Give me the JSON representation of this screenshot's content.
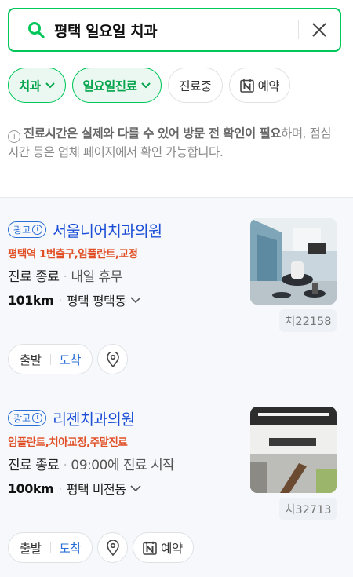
{
  "search": {
    "query": "평택 일요일 치과"
  },
  "filters": [
    {
      "label": "치과"
    },
    {
      "label": "일요일진료"
    },
    {
      "label": "진료중"
    },
    {
      "label": "예약"
    }
  ],
  "notice": {
    "info_glyph": "i",
    "bold_text": "진료시간은 실제와 다를 수 있어 방문 전 확인이 필요",
    "rest_text": "하며, 점심시간 등은 업체 페이지에서 확인 가능합니다."
  },
  "places": [
    {
      "ad_label": "광고",
      "ad_info": "i",
      "name": "서울니어치과의원",
      "tags": "평택역 1번출구,임플란트,교정",
      "status": "진료 종료",
      "status_sub": "내일 휴무",
      "distance": "101km",
      "area": "평택 평택동",
      "code": "치22158",
      "actions": {
        "depart": "출발",
        "arrive": "도착"
      }
    },
    {
      "ad_label": "광고",
      "ad_info": "i",
      "name": "리젠치과의원",
      "tags": "임플란트,치아교정,주말진료",
      "status": "진료 종료",
      "status_sub": "09:00에 진료 시작",
      "distance": "100km",
      "area": "평택 비전동",
      "code": "치32713",
      "actions": {
        "depart": "출발",
        "arrive": "도착",
        "reserve": "예약"
      }
    }
  ],
  "colors": {
    "brand_green": "#03c75a",
    "link_blue": "#1c4fd6",
    "tag_orange": "#e04f26"
  },
  "icons": [
    "search-icon",
    "close-icon",
    "chevron-down-icon",
    "naver-booking-icon",
    "info-icon",
    "location-pin-icon"
  ]
}
